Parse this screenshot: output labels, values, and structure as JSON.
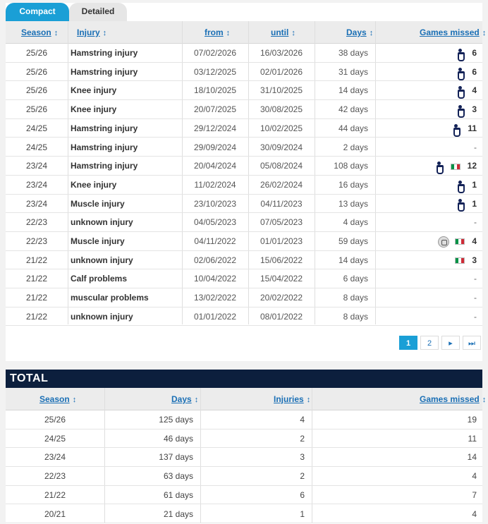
{
  "tabs": {
    "compact": "Compact",
    "detailed": "Detailed"
  },
  "sort_icon": "↕",
  "injury_table": {
    "headers": {
      "season": "Season",
      "injury": "Injury",
      "from": "from",
      "until": "until",
      "days": "Days",
      "games_missed": "Games missed"
    },
    "rows": [
      {
        "season": "25/26",
        "injury": "Hamstring injury",
        "from": "07/02/2026",
        "until": "16/03/2026",
        "days": "38 days",
        "games": "6",
        "icons": [
          "tottenham-crest"
        ]
      },
      {
        "season": "25/26",
        "injury": "Hamstring injury",
        "from": "03/12/2025",
        "until": "02/01/2026",
        "days": "31 days",
        "games": "6",
        "icons": [
          "tottenham-crest"
        ]
      },
      {
        "season": "25/26",
        "injury": "Knee injury",
        "from": "18/10/2025",
        "until": "31/10/2025",
        "days": "14 days",
        "games": "4",
        "icons": [
          "tottenham-crest"
        ]
      },
      {
        "season": "25/26",
        "injury": "Knee injury",
        "from": "20/07/2025",
        "until": "30/08/2025",
        "days": "42 days",
        "games": "3",
        "icons": [
          "tottenham-crest"
        ]
      },
      {
        "season": "24/25",
        "injury": "Hamstring injury",
        "from": "29/12/2024",
        "until": "10/02/2025",
        "days": "44 days",
        "games": "11",
        "icons": [
          "tottenham-crest"
        ]
      },
      {
        "season": "24/25",
        "injury": "Hamstring injury",
        "from": "29/09/2024",
        "until": "30/09/2024",
        "days": "2 days",
        "games": "-",
        "icons": []
      },
      {
        "season": "23/24",
        "injury": "Hamstring injury",
        "from": "20/04/2024",
        "until": "05/08/2024",
        "days": "108 days",
        "games": "12",
        "icons": [
          "tottenham-crest",
          "italy-flag"
        ]
      },
      {
        "season": "23/24",
        "injury": "Knee injury",
        "from": "11/02/2024",
        "until": "26/02/2024",
        "days": "16 days",
        "games": "1",
        "icons": [
          "tottenham-crest"
        ]
      },
      {
        "season": "23/24",
        "injury": "Muscle injury",
        "from": "23/10/2023",
        "until": "04/11/2023",
        "days": "13 days",
        "games": "1",
        "icons": [
          "tottenham-crest"
        ]
      },
      {
        "season": "22/23",
        "injury": "unknown injury",
        "from": "04/05/2023",
        "until": "07/05/2023",
        "days": "4 days",
        "games": "-",
        "icons": []
      },
      {
        "season": "22/23",
        "injury": "Muscle injury",
        "from": "04/11/2022",
        "until": "01/01/2023",
        "days": "59 days",
        "games": "4",
        "icons": [
          "udinese-crest",
          "italy-flag"
        ]
      },
      {
        "season": "21/22",
        "injury": "unknown injury",
        "from": "02/06/2022",
        "until": "15/06/2022",
        "days": "14 days",
        "games": "3",
        "icons": [
          "italy-flag"
        ]
      },
      {
        "season": "21/22",
        "injury": "Calf problems",
        "from": "10/04/2022",
        "until": "15/04/2022",
        "days": "6 days",
        "games": "-",
        "icons": []
      },
      {
        "season": "21/22",
        "injury": "muscular problems",
        "from": "13/02/2022",
        "until": "20/02/2022",
        "days": "8 days",
        "games": "-",
        "icons": []
      },
      {
        "season": "21/22",
        "injury": "unknown injury",
        "from": "01/01/2022",
        "until": "08/01/2022",
        "days": "8 days",
        "games": "-",
        "icons": []
      }
    ]
  },
  "pagination": {
    "pages": [
      "1",
      "2"
    ],
    "current": "1",
    "next": "▸",
    "last": "⏭"
  },
  "total": {
    "title": "TOTAL",
    "headers": {
      "season": "Season",
      "days": "Days",
      "injuries": "Injuries",
      "games_missed": "Games missed"
    },
    "rows": [
      {
        "season": "25/26",
        "days": "125 days",
        "injuries": "4",
        "games": "19"
      },
      {
        "season": "24/25",
        "days": "46 days",
        "injuries": "2",
        "games": "11"
      },
      {
        "season": "23/24",
        "days": "137 days",
        "injuries": "3",
        "games": "14"
      },
      {
        "season": "22/23",
        "days": "63 days",
        "injuries": "2",
        "games": "4"
      },
      {
        "season": "21/22",
        "days": "61 days",
        "injuries": "6",
        "games": "7"
      },
      {
        "season": "20/21",
        "days": "21 days",
        "injuries": "1",
        "games": "4"
      }
    ]
  }
}
